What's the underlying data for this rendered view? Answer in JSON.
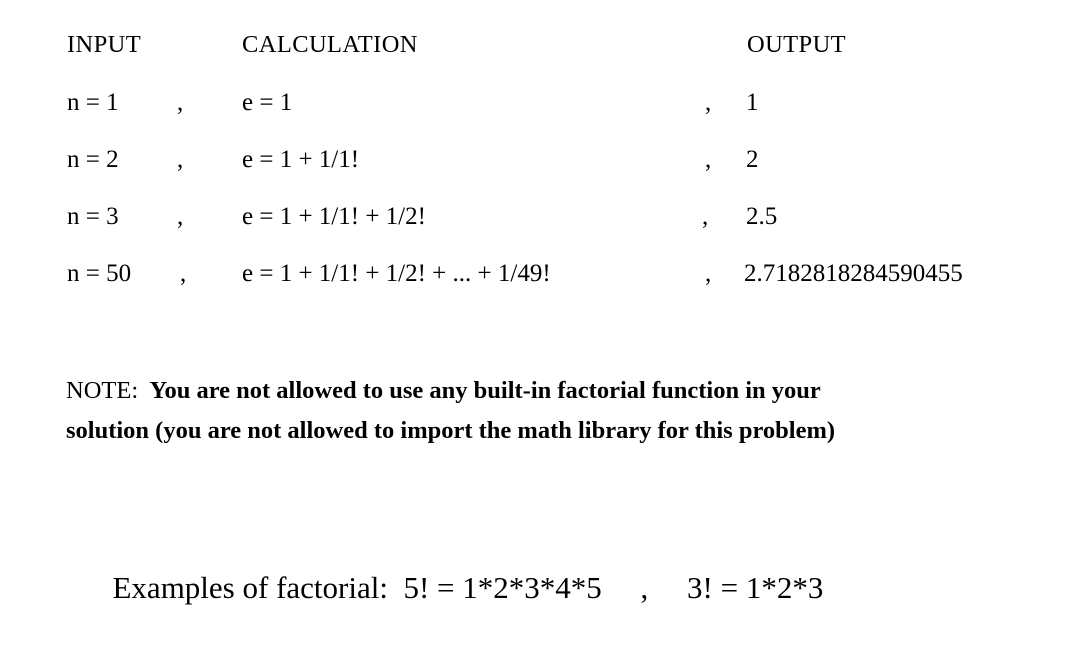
{
  "document": {
    "background_color": "#ffffff",
    "text_color": "#000000"
  },
  "table": {
    "headers": {
      "input": "INPUT",
      "calculation": "CALCULATION",
      "output": "OUTPUT"
    },
    "separator": ",",
    "rows": [
      {
        "input": "n = 1",
        "comma1": ",",
        "calculation": "e = 1",
        "comma2": ",",
        "output": "1"
      },
      {
        "input": "n = 2",
        "comma1": ",",
        "calculation": "e = 1 + 1/1!",
        "comma2": ",",
        "output": "2"
      },
      {
        "input": "n = 3",
        "comma1": ",",
        "calculation": "e = 1 + 1/1! + 1/2!",
        "comma2": ",",
        "output": "2.5"
      },
      {
        "input": "n = 50",
        "comma1": ",",
        "calculation": "e = 1 + 1/1! + 1/2! + ... + 1/49!",
        "comma2": ",",
        "output": "2.7182818284590455"
      }
    ]
  },
  "note": {
    "label": "NOTE:",
    "line1": "You are not allowed to use any built-in factorial function in your",
    "line2": "solution (you are not allowed to import the math library for this problem)"
  },
  "examples": {
    "label": "Examples of factorial:",
    "first": "5! = 1*2*3*4*5",
    "separator": ",",
    "second": "3! = 1*2*3"
  }
}
